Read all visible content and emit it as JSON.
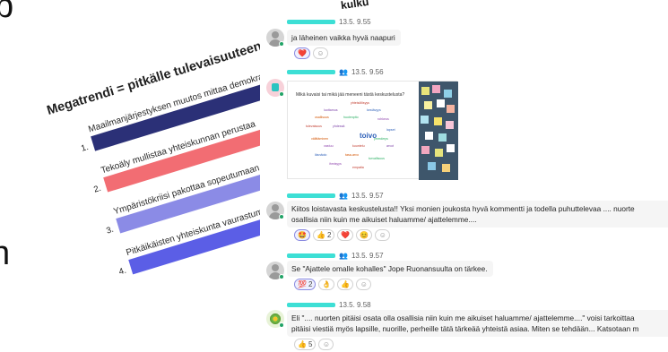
{
  "slide": {
    "top_char": "p",
    "edge_char": "n",
    "title": "Megatrendi = pitkälle tulevaisuuteen suun",
    "items": [
      {
        "num": "1.",
        "text": "Maailmanjärjestyksen muutos mittaa demokratiaa ja",
        "color": "#2b3077"
      },
      {
        "num": "2.",
        "text": "Tekoäly mullistaa yhteiskunnan perustaa",
        "color": "#f26d73"
      },
      {
        "num": "3.",
        "text": "Ympäristökriisi pakottaa sopeutumaan ja u",
        "color": "#8b8be6"
      },
      {
        "num": "4.",
        "text": "Pitkäikäisten yhteiskunta vaurastumi",
        "color": "#5b5ee6"
      }
    ]
  },
  "chat": {
    "header": "kulku",
    "messages": [
      {
        "time": "13.5. 9.55",
        "text": "ja läheinen vaikka hyvä naapuri",
        "reactions": [
          {
            "icon": "❤️",
            "count": ""
          }
        ]
      },
      {
        "time": "13.5. 9.56",
        "attachment": {
          "question": "Mikä kuvaisi tai mikä jää meneeni tästä keskustelusta?",
          "main_word": "toivo",
          "words": [
            "yhteisöllisyys",
            "luottamus",
            "kestävyys",
            "osallisuus",
            "huolenpito",
            "rohkeus",
            "tulevaisuus",
            "yhdessä",
            "lapset",
            "välittäminen",
            "ymmärrys",
            "vastuu",
            "kuuntelu",
            "arvot",
            "läsnäolo",
            "tasa-arvo",
            "turvallisuus",
            "ihmisyys",
            "empatia"
          ]
        }
      },
      {
        "time": "13.5. 9.57",
        "lines": [
          "Kiitos loistavasta keskustelusta!! Yksi monien joukosta hyvä kommentti ja todella puhuttelevaa .... nuorte",
          "osallisia niin kuin me aikuiset haluamme/ ajattelemme...."
        ],
        "reactions": [
          {
            "icon": "🤩",
            "count": "",
            "selected": true
          },
          {
            "icon": "👍",
            "count": "2"
          },
          {
            "icon": "❤️",
            "count": ""
          },
          {
            "icon": "😊",
            "count": ""
          }
        ]
      },
      {
        "time": "13.5. 9.57",
        "text": "Se \"Ajattele omalle kohalles\"  Jope Ruonansuulta on tärkee.",
        "reactions": [
          {
            "icon": "💯",
            "count": "2",
            "selected": true
          },
          {
            "icon": "👌",
            "count": ""
          },
          {
            "icon": "👍",
            "count": ""
          }
        ]
      },
      {
        "time": "13.5. 9.58",
        "lines": [
          "Eli \".... nuorten pitäisi osata olla osallisia niin kuin me aikuiset haluamme/ ajattelemme....\" voisi tarkoittaa",
          "pitäisi viestiä myös lapsille, nuorille, perheille tätä tärkeää yhteistä asiaa. Miten se tehdään... Katsotaan m"
        ],
        "reactions": [
          {
            "icon": "👍",
            "count": "5"
          }
        ]
      }
    ]
  }
}
